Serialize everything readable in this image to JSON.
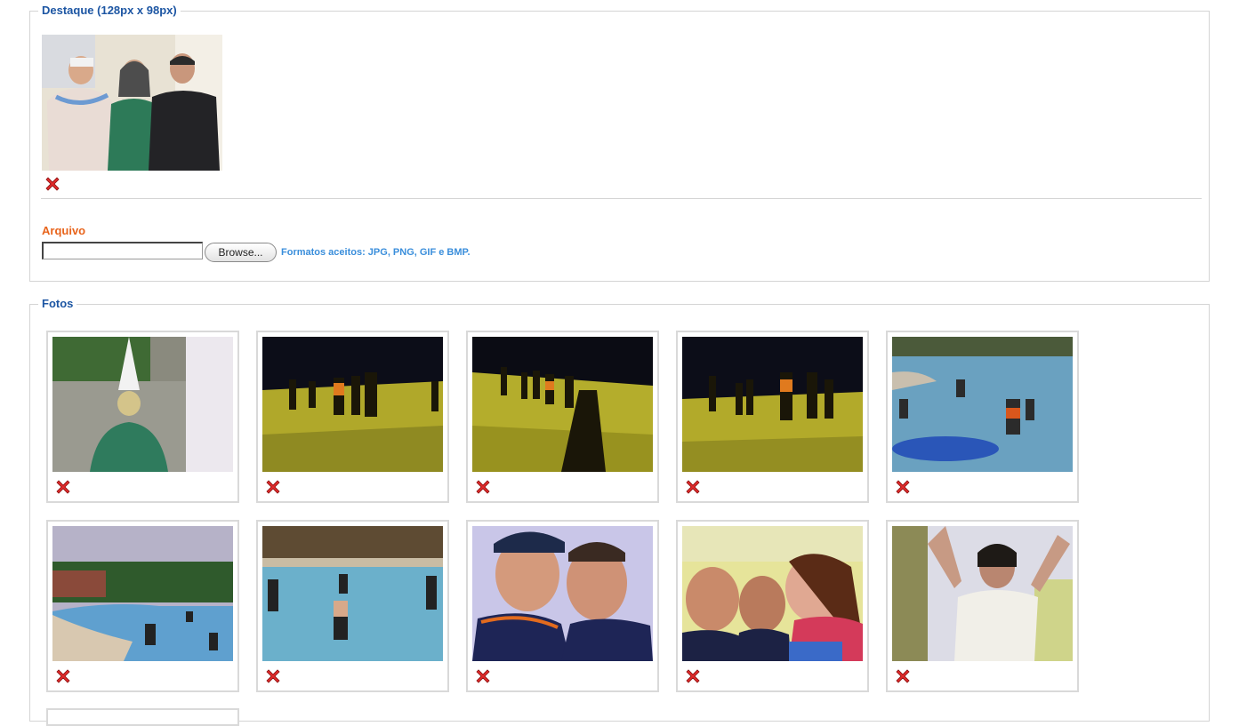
{
  "destaque": {
    "legend": "Destaque (128px x 98px)",
    "image": "featured-photo-three-people-costumes",
    "upload": {
      "label": "Arquivo",
      "file_value": "",
      "browse_label": "Browse...",
      "formats_text": "Formatos aceitos: JPG, PNG, GIF e BMP."
    }
  },
  "fotos": {
    "legend": "Fotos",
    "photos": [
      {
        "name": "photo-costume-person-garden"
      },
      {
        "name": "photo-night-field-group-1"
      },
      {
        "name": "photo-night-field-group-2"
      },
      {
        "name": "photo-night-field-group-3"
      },
      {
        "name": "photo-pool-people-1"
      },
      {
        "name": "photo-pool-palms"
      },
      {
        "name": "photo-pool-people-2"
      },
      {
        "name": "photo-selfie-two-men"
      },
      {
        "name": "photo-selfie-three-friends"
      },
      {
        "name": "photo-woman-arms-up"
      }
    ]
  },
  "colors": {
    "legend": "#1d56a3",
    "arquivo_label": "#e8641c",
    "formats_text": "#3a8edb",
    "delete_icon": "#e02b2b",
    "border": "#d4d4d4"
  },
  "icons": {
    "delete": "red-x-delete-icon"
  }
}
